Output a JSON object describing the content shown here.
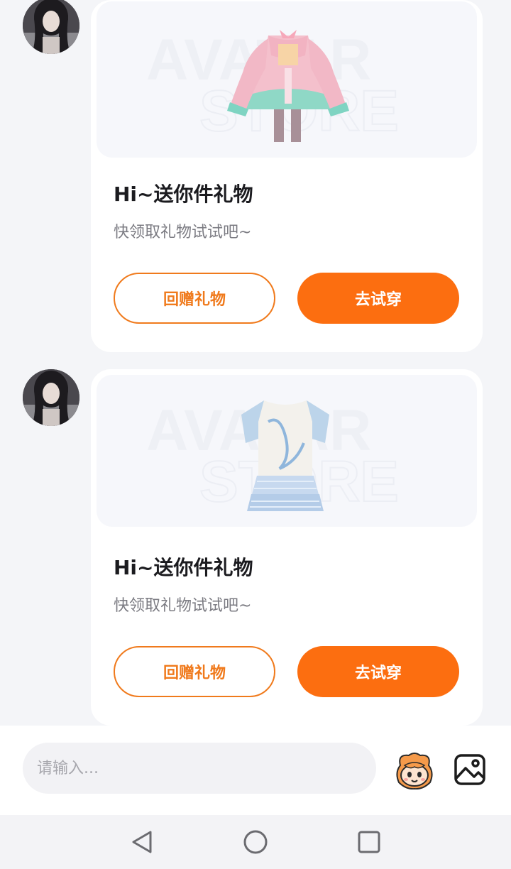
{
  "messages": [
    {
      "watermark_top": "AVATAR",
      "watermark_bottom": "STORE",
      "title": "Hi~送你件礼物",
      "subtitle": "快领取礼物试试吧~",
      "return_gift_label": "回赠礼物",
      "try_on_label": "去试穿",
      "item": "pastel-lolita-dress"
    },
    {
      "watermark_top": "AVATAR",
      "watermark_bottom": "STORE",
      "title": "Hi~送你件礼物",
      "subtitle": "快领取礼物试试吧~",
      "return_gift_label": "回赠礼物",
      "try_on_label": "去试穿",
      "item": "blue-white-tshirt-dress"
    }
  ],
  "input": {
    "placeholder": "请输入..."
  },
  "icons": {
    "sticker": "mascot-face-icon",
    "image": "image-icon",
    "nav_back": "back-triangle-icon",
    "nav_home": "home-circle-icon",
    "nav_recents": "recents-square-icon"
  },
  "colors": {
    "accent": "#fc6e10",
    "outline": "#f07a1c",
    "background": "#f4f5f8"
  }
}
